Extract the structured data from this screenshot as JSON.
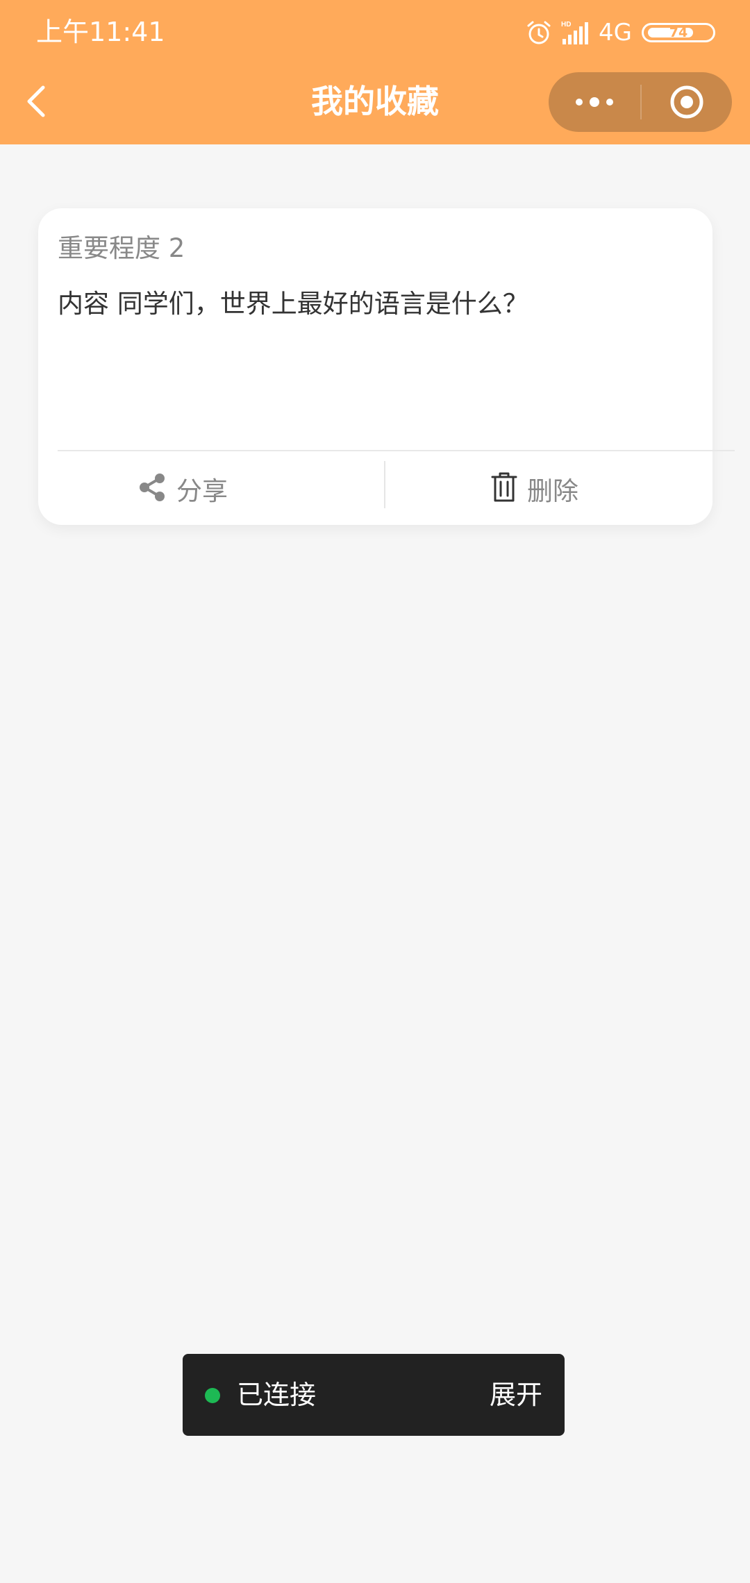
{
  "status_bar": {
    "time": "上午11:41",
    "network": "4G",
    "battery": "74"
  },
  "nav": {
    "title": "我的收藏"
  },
  "card": {
    "importance": "重要程度 2",
    "content": "内容 同学们，世界上最好的语言是什么？",
    "share_label": "分享",
    "delete_label": "删除"
  },
  "toast": {
    "status": "已连接",
    "expand": "展开"
  },
  "colors": {
    "header": "#ffaa5a",
    "capsule": "#c9884a",
    "background": "#f6f6f6",
    "connected_dot": "#1db954"
  }
}
